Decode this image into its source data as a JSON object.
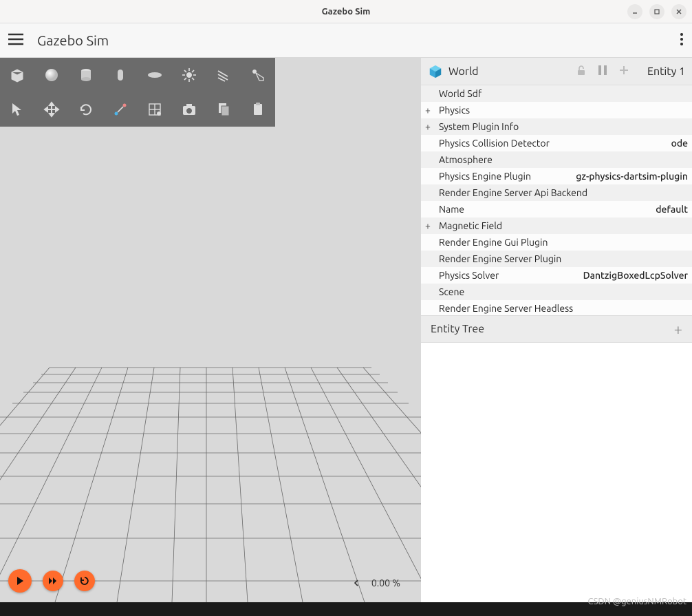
{
  "window": {
    "title": "Gazebo Sim"
  },
  "app": {
    "title": "Gazebo Sim"
  },
  "playback": {
    "percent": "0.00 %"
  },
  "inspector": {
    "title": "World",
    "entity_label": "Entity 1",
    "props": [
      {
        "expand": "",
        "name": "World Sdf",
        "value": "",
        "indent": true
      },
      {
        "expand": "+",
        "name": "Physics",
        "value": "",
        "indent": false
      },
      {
        "expand": "+",
        "name": "System Plugin Info",
        "value": "",
        "indent": false
      },
      {
        "expand": "",
        "name": "Physics Collision Detector",
        "value": "ode",
        "indent": true
      },
      {
        "expand": "",
        "name": "Atmosphere",
        "value": "",
        "indent": true
      },
      {
        "expand": "",
        "name": "Physics Engine Plugin",
        "value": "gz-physics-dartsim-plugin",
        "indent": true
      },
      {
        "expand": "",
        "name": "Render Engine Server Api Backend",
        "value": "",
        "indent": true
      },
      {
        "expand": "",
        "name": "Name",
        "value": "default",
        "indent": true
      },
      {
        "expand": "+",
        "name": "Magnetic Field",
        "value": "",
        "indent": false
      },
      {
        "expand": "",
        "name": "Render Engine Gui Plugin",
        "value": "",
        "indent": true
      },
      {
        "expand": "",
        "name": "Render Engine Server Plugin",
        "value": "",
        "indent": true
      },
      {
        "expand": "",
        "name": "Physics Solver",
        "value": "DantzigBoxedLcpSolver",
        "indent": true
      },
      {
        "expand": "",
        "name": "Scene",
        "value": "",
        "indent": true
      },
      {
        "expand": "",
        "name": "Render Engine Server Headless",
        "value": "",
        "indent": true
      }
    ]
  },
  "tree": {
    "title": "Entity Tree"
  },
  "watermark": "CSDN @geniusNMRobot"
}
